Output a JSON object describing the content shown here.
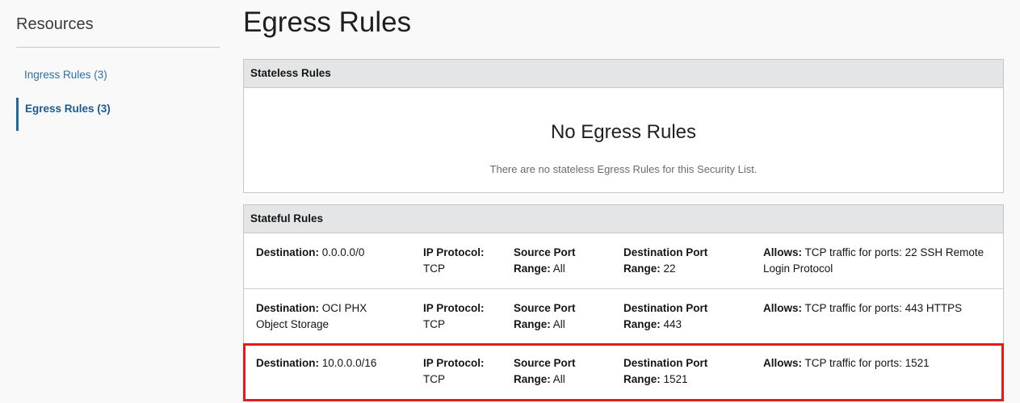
{
  "sidebar": {
    "title": "Resources",
    "items": [
      {
        "label": "Ingress Rules (3)"
      },
      {
        "label": "Egress Rules (3)"
      }
    ]
  },
  "page": {
    "title": "Egress Rules"
  },
  "stateless": {
    "header": "Stateless Rules",
    "empty_title": "No Egress Rules",
    "empty_text": "There are no stateless Egress Rules for this Security List."
  },
  "stateful": {
    "header": "Stateful Rules",
    "labels": {
      "destination": "Destination:",
      "ip_protocol": "IP Protocol:",
      "source_port_a": "Source Port",
      "source_port_b": "Range:",
      "dest_port_a": "Destination Port",
      "dest_port_b": "Range:",
      "allows": "Allows:"
    },
    "rows": [
      {
        "destination": "0.0.0.0/0",
        "protocol": "TCP",
        "source_range": "All",
        "dest_range": "22",
        "allows": "TCP traffic for ports: 22 SSH Remote Login Protocol"
      },
      {
        "destination": "OCI PHX Object Storage",
        "protocol": "TCP",
        "source_range": "All",
        "dest_range": "443",
        "allows": "TCP traffic for ports: 443 HTTPS"
      },
      {
        "destination": "10.0.0.0/16",
        "protocol": "TCP",
        "source_range": "All",
        "dest_range": "1521",
        "allows": "TCP traffic for ports: 1521"
      }
    ]
  },
  "colors": {
    "accent": "#1f6aa5",
    "highlight": "#e31b1b",
    "header_bg": "#e3e5e7"
  }
}
